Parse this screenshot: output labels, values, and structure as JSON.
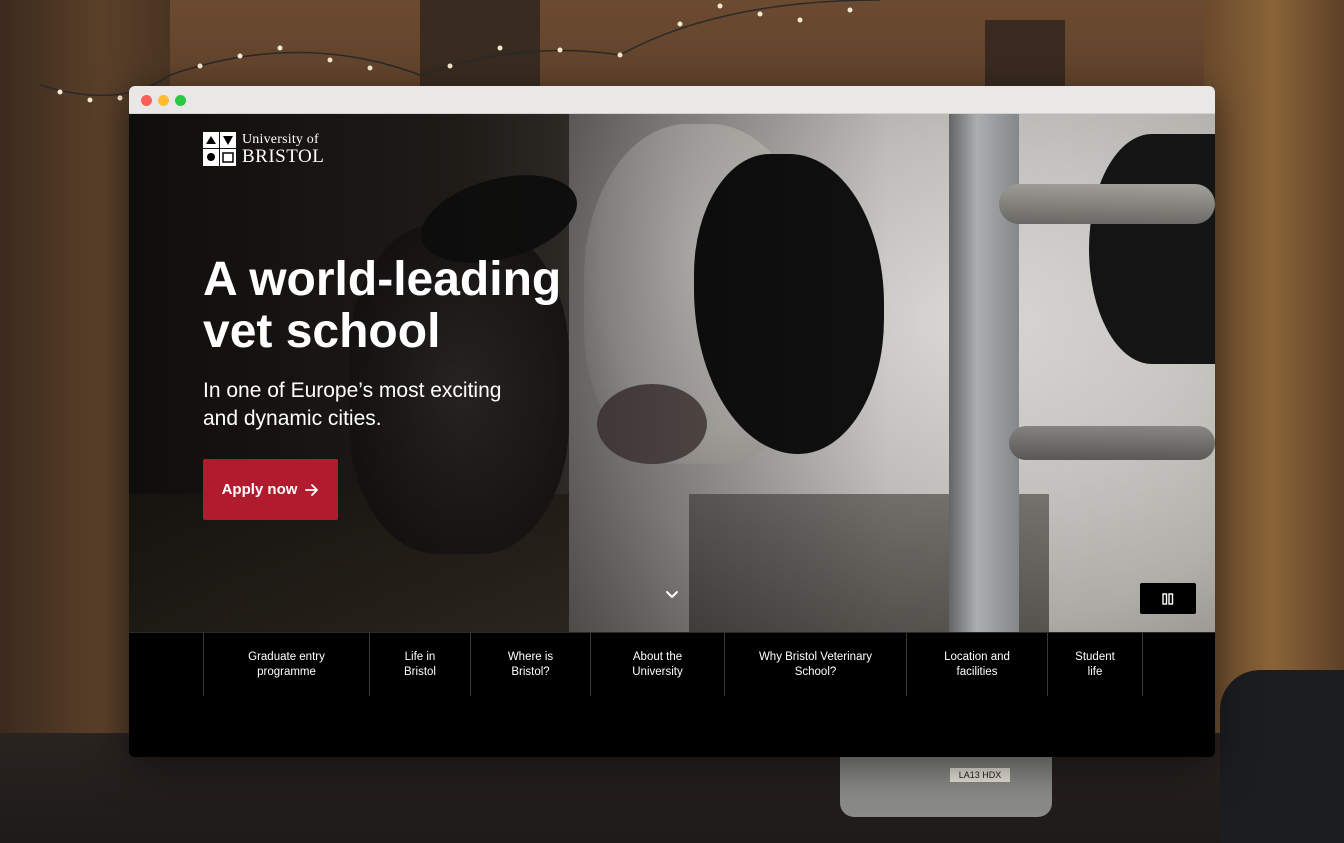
{
  "window": {
    "controls": [
      "close",
      "minimize",
      "maximize"
    ]
  },
  "logo": {
    "line1": "University of",
    "line2": "BRISTOL",
    "icon": "university-crest-icon"
  },
  "hero": {
    "headline_line1": "A world-leading",
    "headline_line2": "vet school",
    "subline_line1": "In one of Europe’s most exciting",
    "subline_line2": "and dynamic cities.",
    "apply_label": "Apply now",
    "apply_icon": "arrow-right-icon",
    "scroll_icon": "chevron-down-icon",
    "pause_icon": "pause-icon",
    "accent_color": "#b01c2e"
  },
  "nav": {
    "items": [
      {
        "line1": "Graduate entry",
        "line2": "programme"
      },
      {
        "line1": "Life in",
        "line2": "Bristol"
      },
      {
        "line1": "Where is",
        "line2": "Bristol?"
      },
      {
        "line1": "About the",
        "line2": "University"
      },
      {
        "line1": "Why Bristol Veterinary",
        "line2": "School?"
      },
      {
        "line1": "Location and",
        "line2": "facilities"
      },
      {
        "line1": "Student",
        "line2": "life"
      }
    ]
  },
  "background": {
    "plate_text": "LA13 HDX"
  }
}
